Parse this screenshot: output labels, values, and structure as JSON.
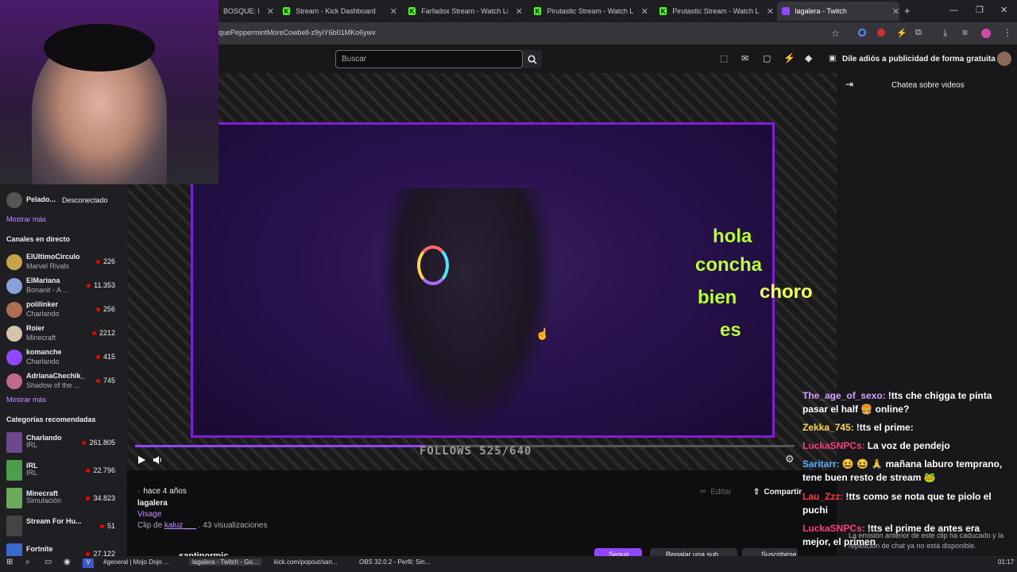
{
  "browser": {
    "tabs": [
      {
        "label": "BOSQUE: MI",
        "active": false
      },
      {
        "label": "Stream - Kick Dashboard",
        "active": false
      },
      {
        "label": "Farfadox Stream - Watch Live c",
        "active": false
      },
      {
        "label": "Pirutastic Stream - Watch Live c",
        "active": false
      },
      {
        "label": "Pirutastic Stream - Watch Live c",
        "active": false
      },
      {
        "label": "lagalera - Twitch",
        "active": true
      }
    ],
    "new_tab": "+",
    "url": "quePeppermintMoreCowbell-z9yiY6b01MKo6ywv"
  },
  "twitch": {
    "search_placeholder": "Buscar",
    "ad_free": "Dile adiós a publicidad de forma gratuita"
  },
  "sidebar": {
    "top_item": {
      "name": "Pelado...",
      "status": "Desconectado"
    },
    "show_more_1": "Mostrar más",
    "live_header": "Canales en directo",
    "channels": [
      {
        "name": "ElUltimoCirculo",
        "sub": "Marvel Rivals",
        "viewers": "226",
        "color": "#c9a34a"
      },
      {
        "name": "ElMariana",
        "sub": "Bonanit - A ...",
        "viewers": "11.353",
        "color": "#8aa0d8"
      },
      {
        "name": "polilinker",
        "sub": "Charlando",
        "viewers": "256",
        "color": "#b07050"
      },
      {
        "name": "Roier",
        "sub": "Minecraft",
        "viewers": "2212",
        "color": "#d6c4a8"
      },
      {
        "name": "komanche",
        "sub": "Charlando",
        "viewers": "415",
        "color": "#9146ff"
      },
      {
        "name": "AdrianaChechik_",
        "sub": "Shadow of the ...",
        "viewers": "745",
        "color": "#c06a8a"
      }
    ],
    "show_more_2": "Mostrar más",
    "cat_header": "Categorías recomendadas",
    "categories": [
      {
        "name": "Charlando",
        "sub": "IRL",
        "viewers": "261.805",
        "color": "#6a4a8a"
      },
      {
        "name": "IRL",
        "sub": "IRL",
        "viewers": "22.796",
        "color": "#4aa04a"
      },
      {
        "name": "Minecraft",
        "sub": "Simulación",
        "viewers": "34.823",
        "color": "#6aaa5a"
      },
      {
        "name": "Stream For Hu...",
        "sub": "",
        "viewers": "51",
        "color": "#444"
      },
      {
        "name": "Fortnite",
        "sub": "",
        "viewers": "27.122",
        "color": "#3a6ad0"
      }
    ]
  },
  "player": {
    "overlay_words": [
      "hola",
      "concha",
      "bien",
      "es",
      "choro"
    ],
    "follows": "FOLLOWS 525/640",
    "progress": 0.44
  },
  "clip": {
    "age": "hace 4 años",
    "channel": "lagalera",
    "game": "Visage",
    "clip_by_label": "Clip de",
    "clip_by": "kaluz___",
    "views": ". 43 visualizaciones",
    "edit": "Editar",
    "share": "Compartir",
    "bottom_name": "santinormic",
    "follow": "Seguir",
    "gift": "Regalar una sub",
    "subscribe": "Suscribirse"
  },
  "chat": {
    "header": "Chatea sobre videos",
    "expired": "La emisión anterior de este clip ha caducado y la repetición de chat ya no está disponible.",
    "messages": [
      {
        "user": "The_age_of_sexo:",
        "text": "!tts che chigga te pinta pasar el half 🍔 online?",
        "color": "#d4a0ff"
      },
      {
        "user": "Zekka_745:",
        "text": "!tts el prime:",
        "color": "#ffd84a"
      },
      {
        "user": "LuckaSNPCs:",
        "text": "La voz de pendejo",
        "color": "#ff3b7f"
      },
      {
        "user": "Saritarr:",
        "text": "😆 😆 🙏 mañana laburo temprano, tene buen resto de stream 🐸",
        "color": "#5ab0ff"
      },
      {
        "user": "Lau_Zzz:",
        "text": "!tts como se nota que te piolo el puchi",
        "color": "#ff3b3b"
      },
      {
        "user": "LuckaSNPCs:",
        "text": "!tts el prime de antes era mejor, el primen",
        "color": "#ff3b7f"
      },
      {
        "user": "Lau_Zzz:",
        "text": "Pucho*",
        "color": "#ff3b3b"
      }
    ]
  },
  "taskbar": {
    "items": [
      "#general | Mojo Dojo ...",
      "lagalera - Twitch - Go...",
      "kick.com/popout/san...",
      "OBS 32.0.2 - Perfil: Sin..."
    ],
    "time": "01:17"
  }
}
